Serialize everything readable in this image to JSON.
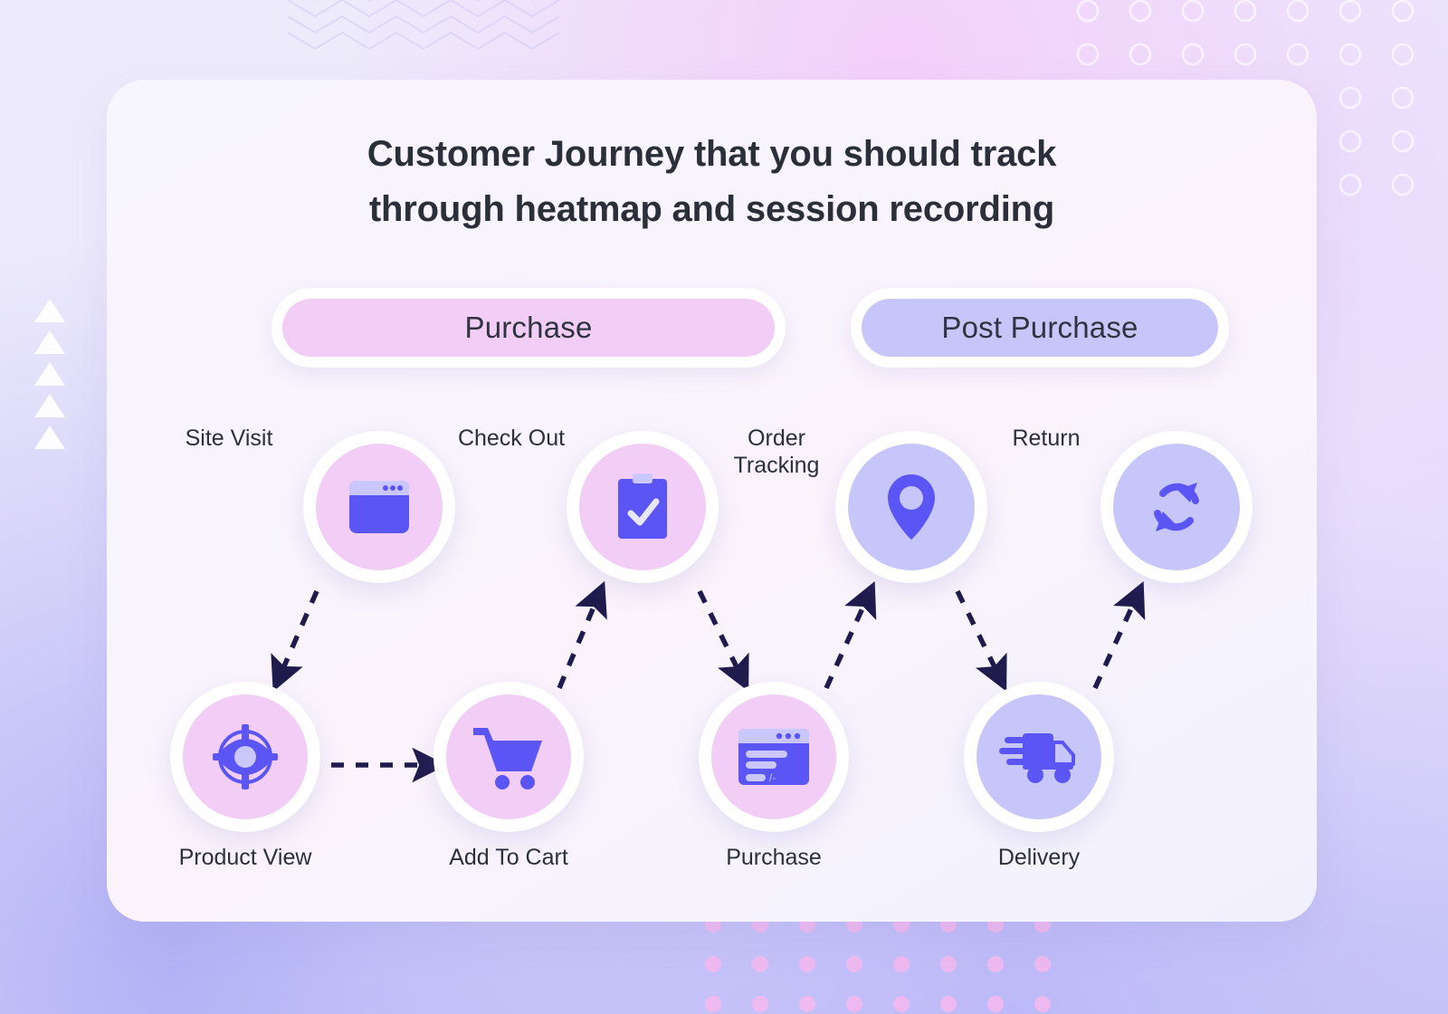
{
  "title": {
    "line1": "Customer Journey that you should track",
    "line2": "through heatmap and session recording"
  },
  "phases": [
    {
      "id": "purchase",
      "label": "Purchase",
      "color": "#f2cdf6"
    },
    {
      "id": "post_purchase",
      "label": "Post Purchase",
      "color": "#c7c6fa"
    }
  ],
  "top_row": [
    {
      "label": "Site Visit",
      "icon": "browser-window-icon",
      "fill": "#f2cdf6"
    },
    {
      "label": "Check Out",
      "icon": "clipboard-check-icon",
      "fill": "#f2cdf6"
    },
    {
      "label": "Order\nTracking",
      "icon": "map-pin-icon",
      "fill": "#c7c6fa"
    },
    {
      "label": "Return",
      "icon": "refresh-arrows-icon",
      "fill": "#c7c6fa"
    }
  ],
  "bottom_row": [
    {
      "label": "Product View",
      "icon": "eye-target-icon",
      "fill": "#f2cdf6"
    },
    {
      "label": "Add To Cart",
      "icon": "shopping-cart-icon",
      "fill": "#f2cdf6"
    },
    {
      "label": "Purchase",
      "icon": "payment-window-icon",
      "fill": "#f2cdf6"
    },
    {
      "label": "Delivery",
      "icon": "delivery-truck-icon",
      "fill": "#c7c6fa"
    }
  ],
  "flow": {
    "sequence": [
      "Site Visit",
      "Product View",
      "Add To Cart",
      "Check Out",
      "Purchase",
      "Order Tracking",
      "Delivery",
      "Return"
    ],
    "connector_style": "dashed-arrow",
    "connector_color": "#1f1b4d"
  },
  "colors": {
    "icon_blue": "#5b55f5",
    "icon_light": "#c9c7fb",
    "pink_fill": "#f2cdf6",
    "periwinkle_fill": "#c7c6fa",
    "text_dark": "#2b303b",
    "card_bg": "#f7f5fe"
  }
}
